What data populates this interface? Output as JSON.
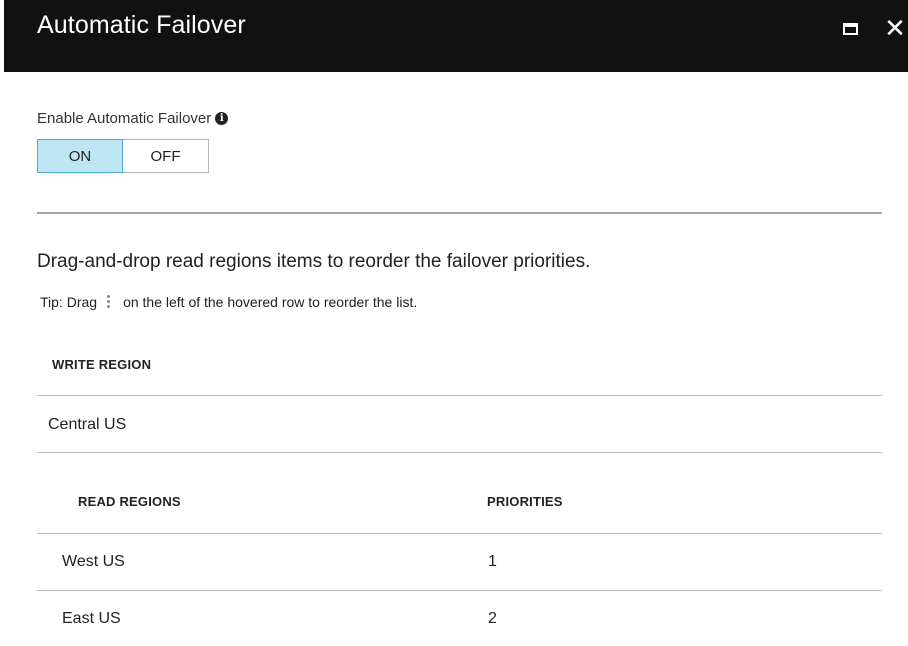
{
  "blade": {
    "title": "Automatic Failover",
    "maximize_icon": "maximize-icon",
    "close_glyph": "✕"
  },
  "failover": {
    "enable_label": "Enable Automatic Failover",
    "info_icon_glyph": "i",
    "toggle": {
      "on_label": "ON",
      "off_label": "OFF",
      "selected": "ON"
    }
  },
  "regions": {
    "instruction": "Drag-and-drop read regions items to reorder the failover priorities.",
    "tip_prefix": "Tip: Drag",
    "tip_suffix": "on the left of the hovered row to reorder the list.",
    "write_region_header": "WRITE REGION",
    "write_region": "Central US",
    "read_regions_header": "READ REGIONS",
    "priorities_header": "PRIORITIES",
    "read_regions": [
      {
        "name": "West US",
        "priority": "1"
      },
      {
        "name": "East US",
        "priority": "2"
      }
    ]
  },
  "colors": {
    "titlebar_bg": "#111111",
    "toggle_on_bg": "#bfe6f5",
    "toggle_on_border": "#4da9d6"
  }
}
